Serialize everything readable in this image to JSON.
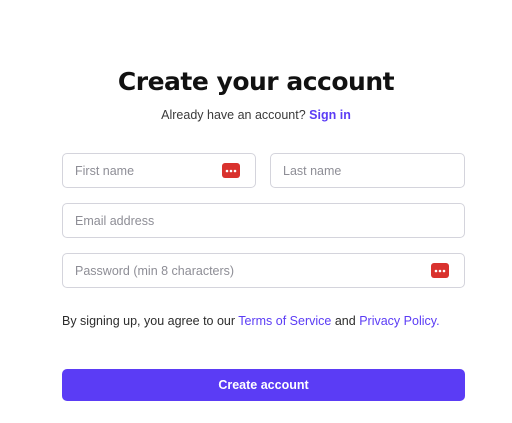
{
  "header": {
    "title": "Create your account",
    "subtitle_text": "Already have an account?",
    "signin_link": "Sign in"
  },
  "form": {
    "first_name": {
      "placeholder": "First name",
      "value": ""
    },
    "last_name": {
      "placeholder": "Last name",
      "value": ""
    },
    "email": {
      "placeholder": "Email address",
      "value": ""
    },
    "password": {
      "placeholder": "Password (min 8 characters)",
      "value": ""
    }
  },
  "terms": {
    "prefix": "By signing up, you agree to our",
    "terms_link": "Terms of Service",
    "conjunction": "and",
    "privacy_link": "Privacy Policy."
  },
  "submit_label": "Create account",
  "icons": {
    "password_manager": "password-manager-icon"
  },
  "colors": {
    "accent": "#5b3cf5",
    "password_manager_icon": "#d9322e",
    "field_border": "#d4d4dc",
    "title_text": "#111111"
  }
}
